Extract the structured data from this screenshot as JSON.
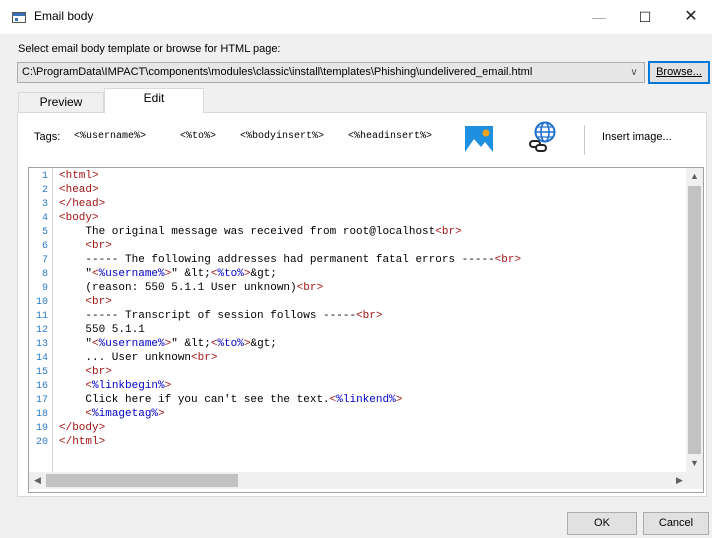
{
  "window": {
    "title": "Email body",
    "controls": {
      "minimize": "—",
      "maximize": "☐",
      "close": "✕"
    }
  },
  "prompt": "Select email body template or browse for HTML page:",
  "path": {
    "value": "C:\\ProgramData\\IMPACT\\components\\modules\\classic\\install\\templates\\Phishing\\undelivered_email.html",
    "arrow": "∨"
  },
  "browse_label": "Browse...",
  "tabs": [
    {
      "label": "Preview",
      "active": false
    },
    {
      "label": "Edit",
      "active": true
    }
  ],
  "toolbar": {
    "tags_label": "Tags:",
    "tags": [
      "<%username%>",
      "<%to%>",
      "<%bodyinsert%>",
      "<%headinsert%>"
    ],
    "icons": [
      "image-icon",
      "globe-link-icon"
    ],
    "insert_image_label": "Insert image..."
  },
  "editor": {
    "line_numbers": [
      "1",
      "2",
      "3",
      "4",
      "5",
      "6",
      "7",
      "8",
      "9",
      "10",
      "11",
      "12",
      "13",
      "14",
      "15",
      "16",
      "17",
      "18",
      "19",
      "20"
    ],
    "lines": [
      "<html>",
      "<head>",
      "</head>",
      "<body>",
      "    The original message was received from root@localhost<br>",
      "    <br>",
      "    ----- The following addresses had permanent fatal errors -----<br>",
      "    \"<%username%>\" &lt;<%to%>&gt;",
      "    (reason: 550 5.1.1 User unknown)<br>",
      "    <br>",
      "    ----- Transcript of session follows -----<br>",
      "    550 5.1.1",
      "    \"<%username%>\" &lt;<%to%>&gt;",
      "    ... User unknown<br>",
      "    <br>",
      "    <%linkbegin%>",
      "    Click here if you can't see the text.<%linkend%>",
      "    <%imagetag%>",
      "</body>",
      "</html>"
    ],
    "scroll_arrows": {
      "up": "▲",
      "down": "▼",
      "left": "◀",
      "right": "▶"
    }
  },
  "buttons": {
    "ok": "OK",
    "cancel": "Cancel"
  },
  "colors": {
    "accent": "#0078d7",
    "tag_color": "#a31515",
    "template_var_color": "#0000cc",
    "line_number_color": "#2b7ac9"
  }
}
